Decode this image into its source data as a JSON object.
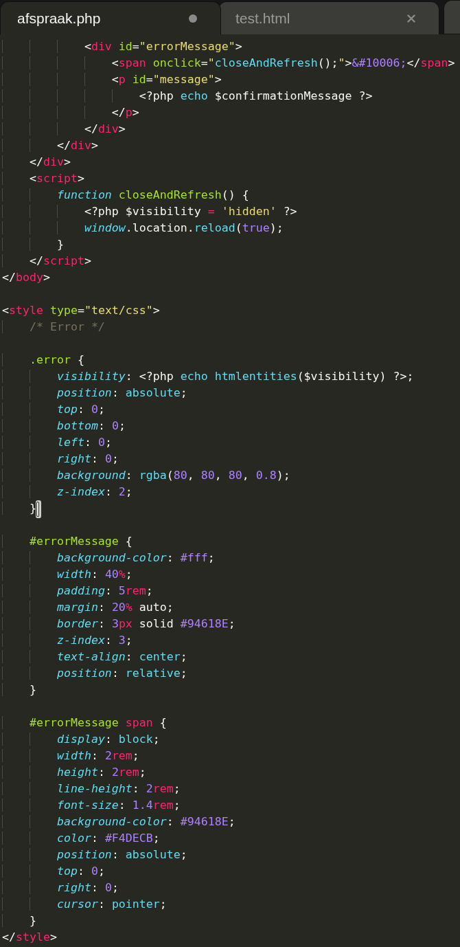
{
  "tabs": [
    {
      "label": "afspraak.php",
      "selected": true,
      "modified": true
    },
    {
      "label": "test.html",
      "selected": false,
      "modified": false
    }
  ],
  "lines": [
    {
      "kind": "code",
      "cursor": false,
      "tokens": [
        {
          "kind": "plain",
          "text": "            <"
        },
        {
          "kind": "tag",
          "text": "div"
        },
        {
          "kind": "attr",
          "text": " id"
        },
        {
          "kind": "plain",
          "text": "="
        },
        {
          "kind": "string",
          "text": "\"errorMessage\""
        },
        {
          "kind": "plain",
          "text": ">"
        }
      ]
    },
    {
      "kind": "code",
      "cursor": false,
      "tokens": [
        {
          "kind": "plain",
          "text": "                <"
        },
        {
          "kind": "tag",
          "text": "span"
        },
        {
          "kind": "attr",
          "text": " onclick"
        },
        {
          "kind": "plain",
          "text": "="
        },
        {
          "kind": "string",
          "text": "\""
        },
        {
          "kind": "support",
          "text": "closeAndRefresh"
        },
        {
          "kind": "plain",
          "text": "();"
        },
        {
          "kind": "string",
          "text": "\""
        },
        {
          "kind": "plain",
          "text": ">"
        },
        {
          "kind": "constant",
          "text": "&#10006;"
        },
        {
          "kind": "plain",
          "text": "</"
        },
        {
          "kind": "tag",
          "text": "span"
        },
        {
          "kind": "plain",
          "text": ">"
        }
      ]
    },
    {
      "kind": "code",
      "cursor": false,
      "tokens": [
        {
          "kind": "plain",
          "text": "                <"
        },
        {
          "kind": "tag",
          "text": "p"
        },
        {
          "kind": "attr",
          "text": " id"
        },
        {
          "kind": "plain",
          "text": "="
        },
        {
          "kind": "string",
          "text": "\"message\""
        },
        {
          "kind": "plain",
          "text": ">"
        }
      ]
    },
    {
      "kind": "code",
      "cursor": false,
      "tokens": [
        {
          "kind": "plain",
          "text": "                    <?php "
        },
        {
          "kind": "support",
          "text": "echo"
        },
        {
          "kind": "plain",
          "text": " $confirmationMessage ?>"
        }
      ]
    },
    {
      "kind": "code",
      "cursor": false,
      "tokens": [
        {
          "kind": "plain",
          "text": "                </"
        },
        {
          "kind": "tag",
          "text": "p"
        },
        {
          "kind": "plain",
          "text": ">"
        }
      ]
    },
    {
      "kind": "code",
      "cursor": false,
      "tokens": [
        {
          "kind": "plain",
          "text": "            </"
        },
        {
          "kind": "tag",
          "text": "div"
        },
        {
          "kind": "plain",
          "text": ">"
        }
      ]
    },
    {
      "kind": "code",
      "cursor": false,
      "tokens": [
        {
          "kind": "plain",
          "text": "        </"
        },
        {
          "kind": "tag",
          "text": "div"
        },
        {
          "kind": "plain",
          "text": ">"
        }
      ]
    },
    {
      "kind": "code",
      "cursor": false,
      "tokens": [
        {
          "kind": "plain",
          "text": "    </"
        },
        {
          "kind": "tag",
          "text": "div"
        },
        {
          "kind": "plain",
          "text": ">"
        }
      ]
    },
    {
      "kind": "code",
      "cursor": false,
      "tokens": [
        {
          "kind": "plain",
          "text": "    <"
        },
        {
          "kind": "tag",
          "text": "script"
        },
        {
          "kind": "plain",
          "text": ">"
        }
      ]
    },
    {
      "kind": "code",
      "cursor": false,
      "tokens": [
        {
          "kind": "keyword",
          "text": "        function"
        },
        {
          "kind": "name",
          "text": " closeAndRefresh"
        },
        {
          "kind": "plain",
          "text": "() {"
        }
      ]
    },
    {
      "kind": "code",
      "cursor": false,
      "tokens": [
        {
          "kind": "plain",
          "text": "            <?php $visibility "
        },
        {
          "kind": "tag",
          "text": "="
        },
        {
          "kind": "string",
          "text": " 'hidden'"
        },
        {
          "kind": "plain",
          "text": " ?>"
        }
      ]
    },
    {
      "kind": "code",
      "cursor": false,
      "tokens": [
        {
          "kind": "keyword",
          "text": "            window"
        },
        {
          "kind": "plain",
          "text": ".location."
        },
        {
          "kind": "support",
          "text": "reload"
        },
        {
          "kind": "plain",
          "text": "("
        },
        {
          "kind": "constant",
          "text": "true"
        },
        {
          "kind": "plain",
          "text": ");"
        }
      ]
    },
    {
      "kind": "code",
      "cursor": false,
      "tokens": [
        {
          "kind": "plain",
          "text": "        }"
        }
      ]
    },
    {
      "kind": "code",
      "cursor": false,
      "tokens": [
        {
          "kind": "plain",
          "text": "    </"
        },
        {
          "kind": "tag",
          "text": "script"
        },
        {
          "kind": "plain",
          "text": ">"
        }
      ]
    },
    {
      "kind": "code",
      "cursor": false,
      "tokens": [
        {
          "kind": "plain",
          "text": "</"
        },
        {
          "kind": "tag",
          "text": "body"
        },
        {
          "kind": "plain",
          "text": ">"
        }
      ]
    },
    {
      "kind": "blank"
    },
    {
      "kind": "code",
      "cursor": false,
      "tokens": [
        {
          "kind": "plain",
          "text": "<"
        },
        {
          "kind": "tag",
          "text": "style"
        },
        {
          "kind": "attr",
          "text": " type"
        },
        {
          "kind": "plain",
          "text": "="
        },
        {
          "kind": "string",
          "text": "\"text/css\""
        },
        {
          "kind": "plain",
          "text": ">"
        }
      ]
    },
    {
      "kind": "code",
      "cursor": false,
      "tokens": [
        {
          "kind": "comment",
          "text": "    /* Error */"
        }
      ]
    },
    {
      "kind": "blank"
    },
    {
      "kind": "code",
      "cursor": false,
      "tokens": [
        {
          "kind": "name",
          "text": "    .error"
        },
        {
          "kind": "plain",
          "text": " {"
        }
      ]
    },
    {
      "kind": "code",
      "cursor": false,
      "tokens": [
        {
          "kind": "keyword",
          "text": "        visibility"
        },
        {
          "kind": "plain",
          "text": ": <?php "
        },
        {
          "kind": "support",
          "text": "echo"
        },
        {
          "kind": "support",
          "text": " htmlentities"
        },
        {
          "kind": "plain",
          "text": "($visibility) ?>;"
        }
      ]
    },
    {
      "kind": "code",
      "cursor": false,
      "tokens": [
        {
          "kind": "keyword",
          "text": "        position"
        },
        {
          "kind": "plain",
          "text": ": "
        },
        {
          "kind": "support",
          "text": "absolute"
        },
        {
          "kind": "plain",
          "text": ";"
        }
      ]
    },
    {
      "kind": "code",
      "cursor": false,
      "tokens": [
        {
          "kind": "keyword",
          "text": "        top"
        },
        {
          "kind": "plain",
          "text": ": "
        },
        {
          "kind": "constant",
          "text": "0"
        },
        {
          "kind": "plain",
          "text": ";"
        }
      ]
    },
    {
      "kind": "code",
      "cursor": false,
      "tokens": [
        {
          "kind": "keyword",
          "text": "        bottom"
        },
        {
          "kind": "plain",
          "text": ": "
        },
        {
          "kind": "constant",
          "text": "0"
        },
        {
          "kind": "plain",
          "text": ";"
        }
      ]
    },
    {
      "kind": "code",
      "cursor": false,
      "tokens": [
        {
          "kind": "keyword",
          "text": "        left"
        },
        {
          "kind": "plain",
          "text": ": "
        },
        {
          "kind": "constant",
          "text": "0"
        },
        {
          "kind": "plain",
          "text": ";"
        }
      ]
    },
    {
      "kind": "code",
      "cursor": false,
      "tokens": [
        {
          "kind": "keyword",
          "text": "        right"
        },
        {
          "kind": "plain",
          "text": ": "
        },
        {
          "kind": "constant",
          "text": "0"
        },
        {
          "kind": "plain",
          "text": ";"
        }
      ]
    },
    {
      "kind": "code",
      "cursor": false,
      "tokens": [
        {
          "kind": "keyword",
          "text": "        background"
        },
        {
          "kind": "plain",
          "text": ": "
        },
        {
          "kind": "support",
          "text": "rgba"
        },
        {
          "kind": "plain",
          "text": "("
        },
        {
          "kind": "constant",
          "text": "80"
        },
        {
          "kind": "plain",
          "text": ", "
        },
        {
          "kind": "constant",
          "text": "80"
        },
        {
          "kind": "plain",
          "text": ", "
        },
        {
          "kind": "constant",
          "text": "80"
        },
        {
          "kind": "plain",
          "text": ", "
        },
        {
          "kind": "constant",
          "text": "0.8"
        },
        {
          "kind": "plain",
          "text": ");"
        }
      ]
    },
    {
      "kind": "code",
      "cursor": false,
      "tokens": [
        {
          "kind": "keyword",
          "text": "        z-index"
        },
        {
          "kind": "plain",
          "text": ": "
        },
        {
          "kind": "constant",
          "text": "2"
        },
        {
          "kind": "plain",
          "text": ";"
        }
      ]
    },
    {
      "kind": "code",
      "cursor": true,
      "tokens": [
        {
          "kind": "plain",
          "text": "    }"
        }
      ]
    },
    {
      "kind": "blank"
    },
    {
      "kind": "code",
      "cursor": false,
      "tokens": [
        {
          "kind": "name",
          "text": "    #errorMessage"
        },
        {
          "kind": "plain",
          "text": " {"
        }
      ]
    },
    {
      "kind": "code",
      "cursor": false,
      "tokens": [
        {
          "kind": "keyword",
          "text": "        background-color"
        },
        {
          "kind": "plain",
          "text": ": "
        },
        {
          "kind": "constant",
          "text": "#fff"
        },
        {
          "kind": "plain",
          "text": ";"
        }
      ]
    },
    {
      "kind": "code",
      "cursor": false,
      "tokens": [
        {
          "kind": "keyword",
          "text": "        width"
        },
        {
          "kind": "plain",
          "text": ": "
        },
        {
          "kind": "constant",
          "text": "40"
        },
        {
          "kind": "unit",
          "text": "%"
        },
        {
          "kind": "plain",
          "text": ";"
        }
      ]
    },
    {
      "kind": "code",
      "cursor": false,
      "tokens": [
        {
          "kind": "keyword",
          "text": "        padding"
        },
        {
          "kind": "plain",
          "text": ": "
        },
        {
          "kind": "constant",
          "text": "5"
        },
        {
          "kind": "unit",
          "text": "rem"
        },
        {
          "kind": "plain",
          "text": ";"
        }
      ]
    },
    {
      "kind": "code",
      "cursor": false,
      "tokens": [
        {
          "kind": "keyword",
          "text": "        margin"
        },
        {
          "kind": "plain",
          "text": ": "
        },
        {
          "kind": "constant",
          "text": "20"
        },
        {
          "kind": "unit",
          "text": "%"
        },
        {
          "kind": "plain",
          "text": " auto;"
        }
      ]
    },
    {
      "kind": "code",
      "cursor": false,
      "tokens": [
        {
          "kind": "keyword",
          "text": "        border"
        },
        {
          "kind": "plain",
          "text": ": "
        },
        {
          "kind": "constant",
          "text": "3"
        },
        {
          "kind": "unit",
          "text": "px"
        },
        {
          "kind": "plain",
          "text": " solid "
        },
        {
          "kind": "constant",
          "text": "#94618E"
        },
        {
          "kind": "plain",
          "text": ";"
        }
      ]
    },
    {
      "kind": "code",
      "cursor": false,
      "tokens": [
        {
          "kind": "keyword",
          "text": "        z-index"
        },
        {
          "kind": "plain",
          "text": ": "
        },
        {
          "kind": "constant",
          "text": "3"
        },
        {
          "kind": "plain",
          "text": ";"
        }
      ]
    },
    {
      "kind": "code",
      "cursor": false,
      "tokens": [
        {
          "kind": "keyword",
          "text": "        text-align"
        },
        {
          "kind": "plain",
          "text": ": "
        },
        {
          "kind": "support",
          "text": "center"
        },
        {
          "kind": "plain",
          "text": ";"
        }
      ]
    },
    {
      "kind": "code",
      "cursor": false,
      "tokens": [
        {
          "kind": "keyword",
          "text": "        position"
        },
        {
          "kind": "plain",
          "text": ": "
        },
        {
          "kind": "support",
          "text": "relative"
        },
        {
          "kind": "plain",
          "text": ";"
        }
      ]
    },
    {
      "kind": "code",
      "cursor": false,
      "tokens": [
        {
          "kind": "plain",
          "text": "    }"
        }
      ]
    },
    {
      "kind": "blank"
    },
    {
      "kind": "code",
      "cursor": false,
      "tokens": [
        {
          "kind": "name",
          "text": "    #errorMessage"
        },
        {
          "kind": "tag",
          "text": " span"
        },
        {
          "kind": "plain",
          "text": " {"
        }
      ]
    },
    {
      "kind": "code",
      "cursor": false,
      "tokens": [
        {
          "kind": "keyword",
          "text": "        display"
        },
        {
          "kind": "plain",
          "text": ": "
        },
        {
          "kind": "support",
          "text": "block"
        },
        {
          "kind": "plain",
          "text": ";"
        }
      ]
    },
    {
      "kind": "code",
      "cursor": false,
      "tokens": [
        {
          "kind": "keyword",
          "text": "        width"
        },
        {
          "kind": "plain",
          "text": ": "
        },
        {
          "kind": "constant",
          "text": "2"
        },
        {
          "kind": "unit",
          "text": "rem"
        },
        {
          "kind": "plain",
          "text": ";"
        }
      ]
    },
    {
      "kind": "code",
      "cursor": false,
      "tokens": [
        {
          "kind": "keyword",
          "text": "        height"
        },
        {
          "kind": "plain",
          "text": ": "
        },
        {
          "kind": "constant",
          "text": "2"
        },
        {
          "kind": "unit",
          "text": "rem"
        },
        {
          "kind": "plain",
          "text": ";"
        }
      ]
    },
    {
      "kind": "code",
      "cursor": false,
      "tokens": [
        {
          "kind": "keyword",
          "text": "        line-height"
        },
        {
          "kind": "plain",
          "text": ": "
        },
        {
          "kind": "constant",
          "text": "2"
        },
        {
          "kind": "unit",
          "text": "rem"
        },
        {
          "kind": "plain",
          "text": ";"
        }
      ]
    },
    {
      "kind": "code",
      "cursor": false,
      "tokens": [
        {
          "kind": "keyword",
          "text": "        font-size"
        },
        {
          "kind": "plain",
          "text": ": "
        },
        {
          "kind": "constant",
          "text": "1.4"
        },
        {
          "kind": "unit",
          "text": "rem"
        },
        {
          "kind": "plain",
          "text": ";"
        }
      ]
    },
    {
      "kind": "code",
      "cursor": false,
      "tokens": [
        {
          "kind": "keyword",
          "text": "        background-color"
        },
        {
          "kind": "plain",
          "text": ": "
        },
        {
          "kind": "constant",
          "text": "#94618E"
        },
        {
          "kind": "plain",
          "text": ";"
        }
      ]
    },
    {
      "kind": "code",
      "cursor": false,
      "tokens": [
        {
          "kind": "keyword",
          "text": "        color"
        },
        {
          "kind": "plain",
          "text": ": "
        },
        {
          "kind": "constant",
          "text": "#F4DECB"
        },
        {
          "kind": "plain",
          "text": ";"
        }
      ]
    },
    {
      "kind": "code",
      "cursor": false,
      "tokens": [
        {
          "kind": "keyword",
          "text": "        position"
        },
        {
          "kind": "plain",
          "text": ": "
        },
        {
          "kind": "support",
          "text": "absolute"
        },
        {
          "kind": "plain",
          "text": ";"
        }
      ]
    },
    {
      "kind": "code",
      "cursor": false,
      "tokens": [
        {
          "kind": "keyword",
          "text": "        top"
        },
        {
          "kind": "plain",
          "text": ": "
        },
        {
          "kind": "constant",
          "text": "0"
        },
        {
          "kind": "plain",
          "text": ";"
        }
      ]
    },
    {
      "kind": "code",
      "cursor": false,
      "tokens": [
        {
          "kind": "keyword",
          "text": "        right"
        },
        {
          "kind": "plain",
          "text": ": "
        },
        {
          "kind": "constant",
          "text": "0"
        },
        {
          "kind": "plain",
          "text": ";"
        }
      ]
    },
    {
      "kind": "code",
      "cursor": false,
      "tokens": [
        {
          "kind": "keyword",
          "text": "        cursor"
        },
        {
          "kind": "plain",
          "text": ": "
        },
        {
          "kind": "support",
          "text": "pointer"
        },
        {
          "kind": "plain",
          "text": ";"
        }
      ]
    },
    {
      "kind": "code",
      "cursor": false,
      "tokens": [
        {
          "kind": "plain",
          "text": "    }"
        }
      ]
    },
    {
      "kind": "code",
      "cursor": false,
      "tokens": [
        {
          "kind": "plain",
          "text": "</"
        },
        {
          "kind": "tag",
          "text": "style"
        },
        {
          "kind": "plain",
          "text": ">"
        }
      ]
    }
  ]
}
